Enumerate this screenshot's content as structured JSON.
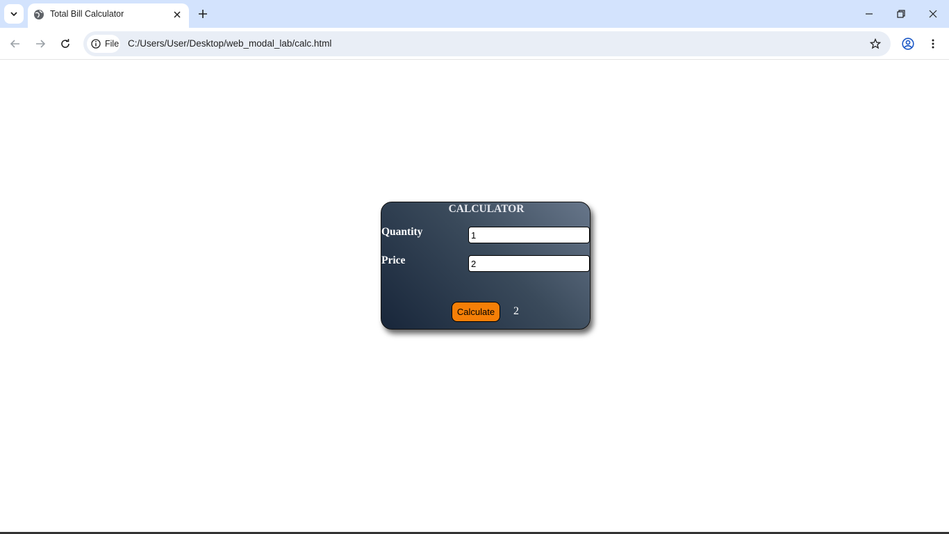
{
  "browser": {
    "tab_title": "Total Bill Calculator",
    "site_chip_label": "File",
    "url": "C:/Users/User/Desktop/web_modal_lab/calc.html"
  },
  "calculator": {
    "title": "CALCULATOR",
    "quantity_label": "Quantity",
    "quantity_value": "1",
    "price_label": "Price",
    "price_value": "2",
    "button_label": "Calculate",
    "result": "2"
  }
}
